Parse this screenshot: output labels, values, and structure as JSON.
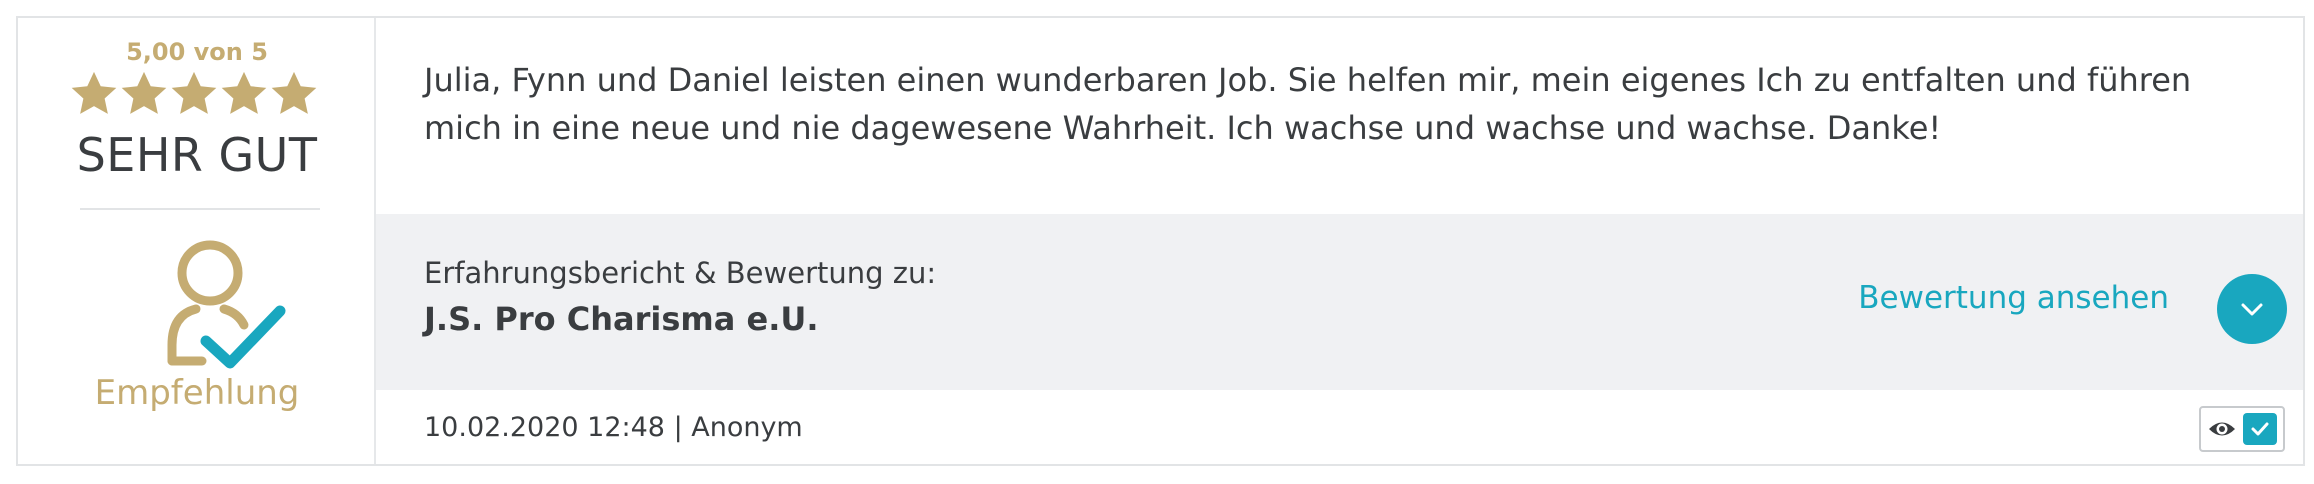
{
  "rating": {
    "score_text": "5,00 von 5",
    "stars": 5,
    "max_stars": 5,
    "verdict": "SEHR GUT",
    "recommendation_label": "Empfehlung"
  },
  "review": {
    "text": "Julia, Fynn und Daniel leisten einen wunderbaren Job. Sie helfen mir, mein eigenes Ich zu entfalten und führen mich in eine neue und nie dagewesene Wahrheit. Ich wachse und wachse und wachse. Danke!",
    "about_label": "Erfahrungsbericht & Bewertung zu:",
    "company": "J.S. Pro Charisma e.U.",
    "view_link": "Bewertung ansehen",
    "meta": "10.02.2020 12:48 | Anonym"
  },
  "colors": {
    "gold": "#c5ac72",
    "accent": "#19a7bf",
    "text": "#3a3d40"
  },
  "icons": [
    "star-icon",
    "recommendation-person-check-icon",
    "chevron-down-icon",
    "eye-icon",
    "check-icon"
  ]
}
